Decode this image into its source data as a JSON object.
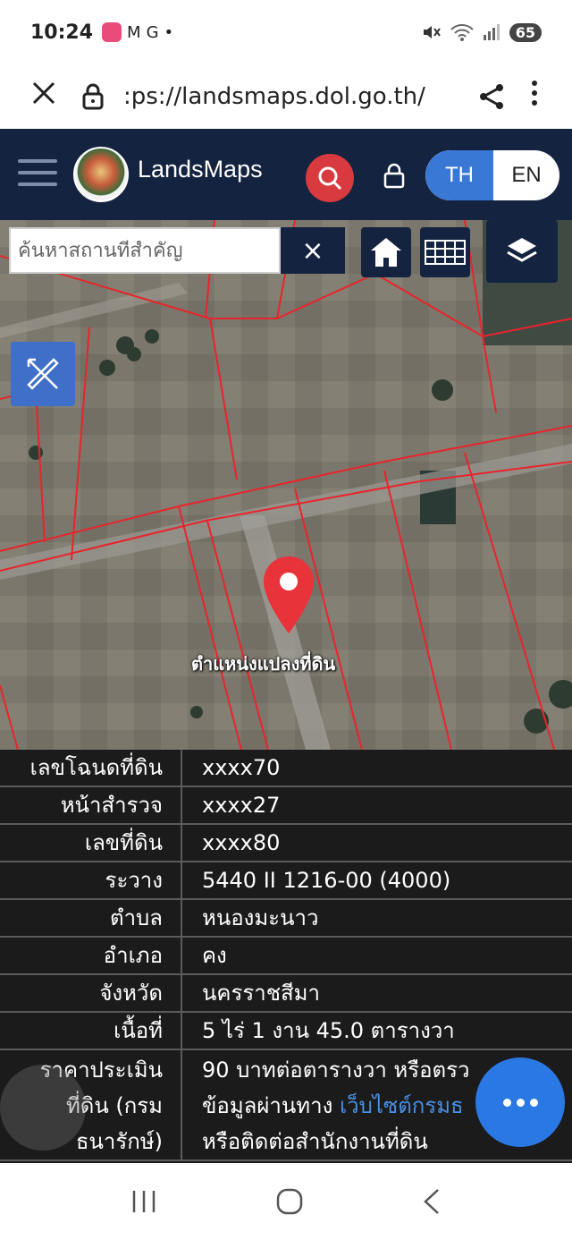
{
  "status": {
    "time": "10:24",
    "app_icons": [
      "M",
      "G",
      "•"
    ],
    "battery": "65"
  },
  "browser": {
    "url": ":ps://landsmaps.dol.go.th/"
  },
  "header": {
    "brand": "LandsMaps",
    "lang_th": "TH",
    "lang_en": "EN"
  },
  "map": {
    "search_placeholder": "ค้นหาสถานที่สำคัญ",
    "clear": "×",
    "pin_label": "ตำแหน่งแปลงที่ดิน"
  },
  "parcel": {
    "rows": [
      {
        "label": "เลขโฉนดที่ดิน",
        "value": "xxxx70"
      },
      {
        "label": "หน้าสำรวจ",
        "value": "xxxx27"
      },
      {
        "label": "เลขที่ดิน",
        "value": "xxxx80"
      },
      {
        "label": "ระวาง",
        "value": "5440 II 1216-00 (4000)"
      },
      {
        "label": "ตำบล",
        "value": "หนองมะนาว"
      },
      {
        "label": "อำเภอ",
        "value": "คง"
      },
      {
        "label": "จังหวัด",
        "value": "นครราชสีมา"
      },
      {
        "label": "เนื้อที่",
        "value": "5 ไร่ 1 งาน 45.0 ตารางวา"
      }
    ],
    "price": {
      "label_lines": [
        "ราคาประเมิน",
        "ที่ดิน (กรม",
        "ธนารักษ์)"
      ],
      "value_line1": "90 บาทต่อตารางวา หรือตรว",
      "value_line2_prefix": "ข้อมูลผ่านทาง ",
      "value_line2_link": "เว็บไซต์กรมธ",
      "value_line3": "หรือติดต่อสำนักงานที่ดิน"
    }
  },
  "colors": {
    "header_bg": "#14233f",
    "search_red": "#d93a3f",
    "accent_blue": "#3a78d6",
    "parcel_line": "#e8242c",
    "fab_blue": "#2a78e4"
  }
}
